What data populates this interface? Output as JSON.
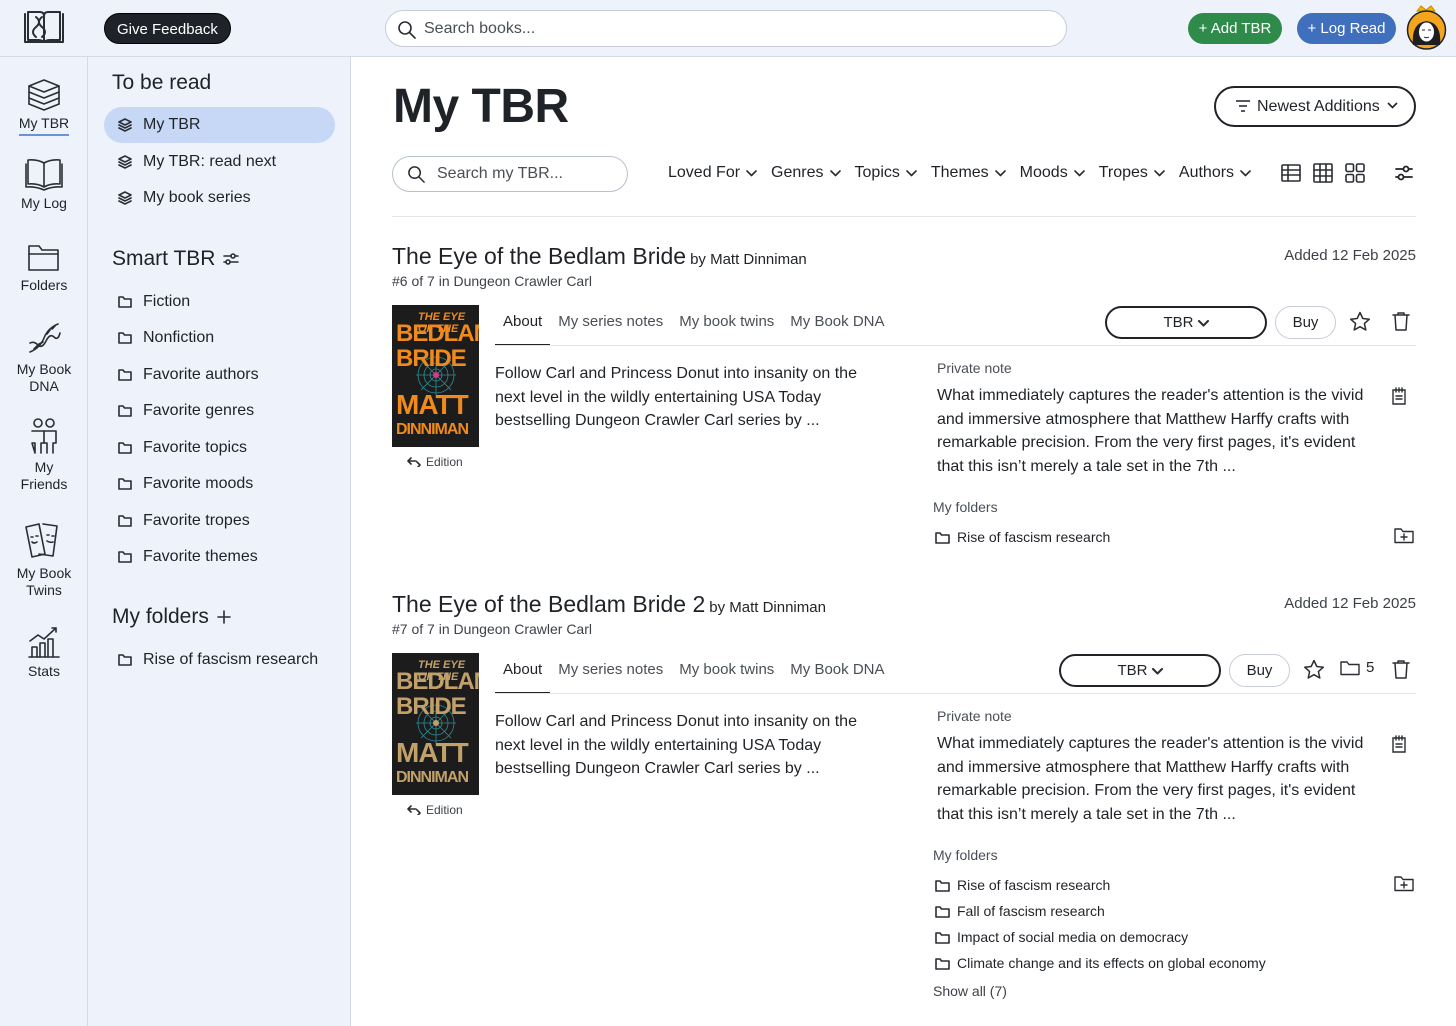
{
  "topbar": {
    "feedback_label": "Give Feedback",
    "search_placeholder": "Search books...",
    "add_tbr_label": "+ Add TBR",
    "log_read_label": "+ Log Read"
  },
  "rail": {
    "items": [
      {
        "label": "My TBR",
        "icon": "books-stack-icon"
      },
      {
        "label": "My Log",
        "icon": "open-book-icon"
      },
      {
        "label": "Folders",
        "icon": "folder-icon"
      },
      {
        "label": "My Book DNA",
        "icon": "dna-icon"
      },
      {
        "label": "My Friends",
        "icon": "friends-icon"
      },
      {
        "label": "My Book Twins",
        "icon": "book-twins-icon"
      },
      {
        "label": "Stats",
        "icon": "stats-icon"
      }
    ]
  },
  "sidebar": {
    "to_be_read_heading": "To be read",
    "tbr_links": [
      "My TBR",
      "My TBR: read next",
      "My book series"
    ],
    "smart_tbr_heading": "Smart TBR",
    "smart_links": [
      "Fiction",
      "Nonfiction",
      "Favorite authors",
      "Favorite genres",
      "Favorite topics",
      "Favorite moods",
      "Favorite tropes",
      "Favorite themes"
    ],
    "my_folders_heading": "My folders",
    "folder_links": [
      "Rise of fascism research"
    ]
  },
  "main": {
    "title": "My TBR",
    "sort_label": "Newest Additions",
    "search_placeholder": "Search my TBR...",
    "filters": [
      "Loved For",
      "Genres",
      "Topics",
      "Themes",
      "Moods",
      "Tropes",
      "Authors"
    ]
  },
  "books": [
    {
      "title": "The Eye of the Bedlam Bride",
      "by": "by Matt Dinniman",
      "added": "Added 12 Feb 2025",
      "series": "#6 of 7 in Dungeon Crawler Carl",
      "cover": {
        "line1": "THE EYE OF THE",
        "line2": "BEDLAM BRIDE",
        "line3": "MATT",
        "line4": "DINNIMAN",
        "color": "#f08a1c"
      },
      "edition": "Edition",
      "tabs": [
        "About",
        "My series notes",
        "My book twins",
        "My Book DNA"
      ],
      "status": "TBR",
      "buy": "Buy",
      "description": "Follow Carl and Princess Donut into insanity on the next level in the wildly entertaining USA Today bestselling Dungeon Crawler Carl series by ...",
      "private_note_label": "Private note",
      "private_note": "What immediately captures the reader's attention is the vivid and immersive atmosphere that Matthew Harffy crafts with remarkable precision. From the very first pages, it's evident that this isn’t merely a tale set in the 7th ...",
      "folders_label": "My folders",
      "folders": [
        "Rise of fascism research"
      ]
    },
    {
      "title": "The Eye of the Bedlam Bride 2",
      "by": "by Matt Dinniman",
      "added": "Added 12 Feb 2025",
      "series": "#7 of 7 in Dungeon Crawler Carl",
      "cover": {
        "line1": "THE EYE OF THE",
        "line2": "BEDLAM BRIDE",
        "line3": "MATT",
        "line4": "DINNIMAN",
        "color": "#c2a06a"
      },
      "edition": "Edition",
      "tabs": [
        "About",
        "My series notes",
        "My book twins",
        "My Book DNA"
      ],
      "status": "TBR",
      "buy": "Buy",
      "folder_count": "5",
      "description": "Follow Carl and Princess Donut into insanity on the next level in the wildly entertaining USA Today bestselling Dungeon Crawler Carl series by ...",
      "private_note_label": "Private note",
      "private_note": "What immediately captures the reader's attention is the vivid and immersive atmosphere that Matthew Harffy crafts with remarkable precision. From the very first pages, it's evident that this isn’t merely a tale set in the 7th ...",
      "folders_label": "My folders",
      "folders": [
        "Rise of fascism research",
        "Fall of fascism research",
        "Impact of social media on democracy",
        "Climate change and its effects on global economy"
      ],
      "show_all": "Show all (7)"
    }
  ]
}
